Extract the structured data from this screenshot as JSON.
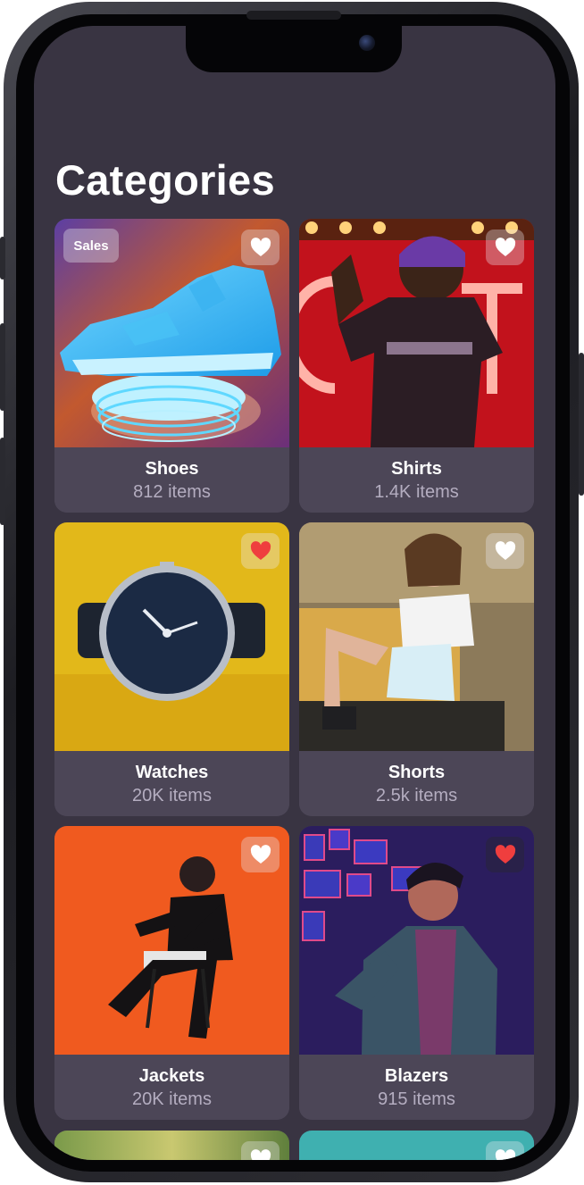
{
  "page_title": "Categories",
  "colors": {
    "screen_bg": "#393442",
    "card_info_bg": "#4c4657",
    "text_primary": "#ffffff",
    "text_secondary": "#b4adc0",
    "favorite_active": "#ef3e3e",
    "favorite_inactive": "#ffffff"
  },
  "categories": [
    {
      "name": "Shoes",
      "count": "812 items",
      "badge": "Sales",
      "favorited": false,
      "icon": "heart-icon"
    },
    {
      "name": "Shirts",
      "count": "1.4K items",
      "favorited": false,
      "icon": "heart-icon"
    },
    {
      "name": "Watches",
      "count": "20K items",
      "favorited": true,
      "icon": "heart-icon"
    },
    {
      "name": "Shorts",
      "count": "2.5k items",
      "favorited": false,
      "icon": "heart-icon"
    },
    {
      "name": "Jackets",
      "count": "20K items",
      "favorited": false,
      "icon": "heart-icon"
    },
    {
      "name": "Blazers",
      "count": "915 items",
      "favorited": true,
      "icon": "heart-icon"
    }
  ]
}
